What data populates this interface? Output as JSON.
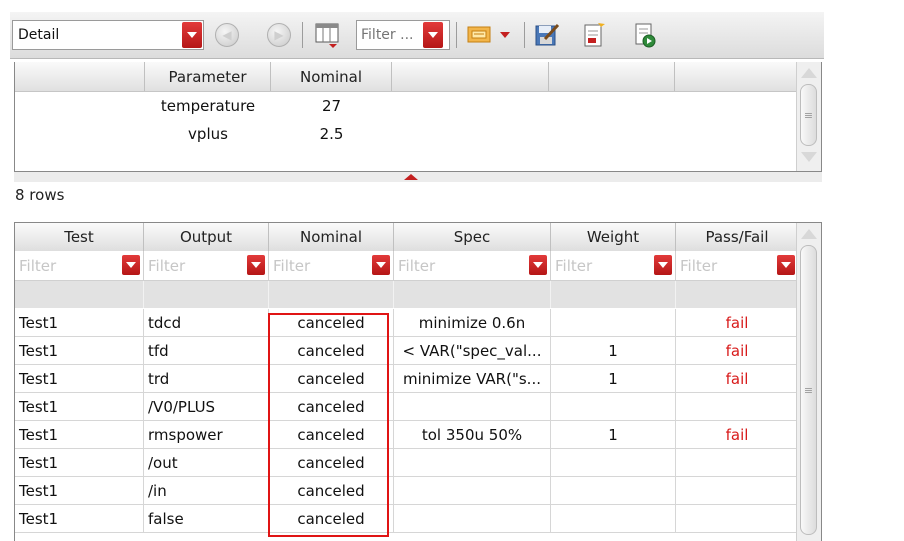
{
  "toolbar": {
    "view_select": "Detail",
    "filter_placeholder": "Filter ...",
    "icons": [
      "back-icon",
      "forward-icon",
      "table-columns-icon",
      "filter-dropdown-icon",
      "image-icon",
      "save-edit-icon",
      "document-icon",
      "run-document-icon"
    ]
  },
  "param_table": {
    "columns": [
      "Parameter",
      "Nominal"
    ],
    "rows": [
      {
        "parameter": "temperature",
        "nominal": "27"
      },
      {
        "parameter": "vplus",
        "nominal": "2.5"
      }
    ]
  },
  "row_count": "8 rows",
  "results": {
    "columns": [
      "Test",
      "Output",
      "Nominal",
      "Spec",
      "Weight",
      "Pass/Fail"
    ],
    "filter_placeholder": "Filter",
    "rows": [
      {
        "test": "Test1",
        "output": "tdcd",
        "nominal": "canceled",
        "spec": "minimize 0.6n",
        "weight": "",
        "passfail": "fail"
      },
      {
        "test": "Test1",
        "output": "tfd",
        "nominal": "canceled",
        "spec": "< VAR(\"spec_val...",
        "weight": "1",
        "passfail": "fail"
      },
      {
        "test": "Test1",
        "output": "trd",
        "nominal": "canceled",
        "spec": "minimize VAR(\"s...",
        "weight": "1",
        "passfail": "fail"
      },
      {
        "test": "Test1",
        "output": "/V0/PLUS",
        "nominal": "canceled",
        "spec": "",
        "weight": "",
        "passfail": ""
      },
      {
        "test": "Test1",
        "output": "rmspower",
        "nominal": "canceled",
        "spec": "tol 350u 50%",
        "weight": "1",
        "passfail": "fail"
      },
      {
        "test": "Test1",
        "output": "/out",
        "nominal": "canceled",
        "spec": "",
        "weight": "",
        "passfail": ""
      },
      {
        "test": "Test1",
        "output": "/in",
        "nominal": "canceled",
        "spec": "",
        "weight": "",
        "passfail": ""
      },
      {
        "test": "Test1",
        "output": "false",
        "nominal": "canceled",
        "spec": "",
        "weight": "",
        "passfail": ""
      }
    ]
  },
  "colors": {
    "accent_red": "#c42020",
    "fail_text": "#d81b1b",
    "highlight_border": "#e01414"
  }
}
